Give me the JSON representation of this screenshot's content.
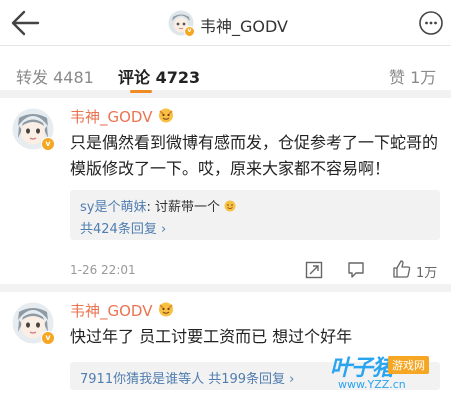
{
  "header": {
    "title": "韦神_GODV",
    "back_icon": "arrow-left-icon",
    "more_icon": "more-dots-icon"
  },
  "tabs": {
    "repost": {
      "label": "转发",
      "count": "4481"
    },
    "comment": {
      "label": "评论",
      "count": "4723"
    },
    "like": {
      "label": "赞",
      "count": "1万"
    }
  },
  "comments": [
    {
      "username": "韦神_GODV",
      "content": "只是偶然看到微博有感而发，仓促参考了一下蛇哥的模版修改了一下。哎，原来大家都不容易啊！",
      "reply": {
        "name": "sy是个萌妹",
        "text": ": 讨薪带一个",
        "more": "共424条回复 ›"
      },
      "time": "1-26 22:01",
      "likes": "1万"
    },
    {
      "username": "韦神_GODV",
      "content": "快过年了 员工讨要工资而已 想过个好年",
      "reply": {
        "text": "7911你猜我是谁等人  共199条回复 ›"
      }
    }
  ],
  "watermark": {
    "brand": "叶子猪",
    "tag": "游戏网",
    "url": "www.YZZ.cn"
  },
  "colors": {
    "accent": "#eb7350",
    "link": "#507daf",
    "tab_indicator": "#f08a24",
    "verified_badge": "#f5a623"
  }
}
